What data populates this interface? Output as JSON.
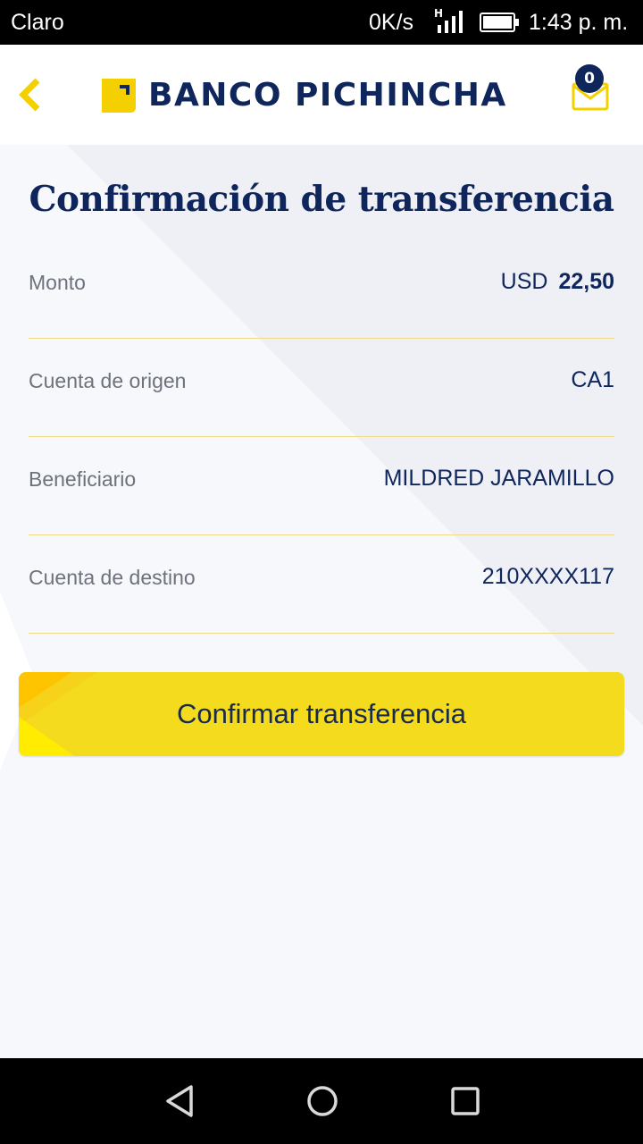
{
  "status_bar": {
    "carrier": "Claro",
    "speed": "0K/s",
    "network": "H",
    "time": "1:43 p. m."
  },
  "header": {
    "brand": "BANCO PICHINCHA",
    "notification_count": "0",
    "icons": {
      "back": "chevron-left-icon",
      "mail": "envelope-icon"
    },
    "colors": {
      "brand_navy": "#0f265c",
      "brand_yellow": "#f5db1e"
    }
  },
  "main": {
    "title": "Confirmación de transferencia",
    "details": [
      {
        "label": "Monto",
        "currency": "USD",
        "value": "22,50"
      },
      {
        "label": "Cuenta de origen",
        "value": "CA1"
      },
      {
        "label": "Beneficiario",
        "value": "MILDRED JARAMILLO"
      },
      {
        "label": "Cuenta de destino",
        "value": "210XXXX117"
      }
    ],
    "confirm_label": "Confirmar transferencia"
  },
  "nav_bar": {
    "icons": [
      "back-triangle-icon",
      "home-circle-icon",
      "recents-square-icon"
    ]
  }
}
